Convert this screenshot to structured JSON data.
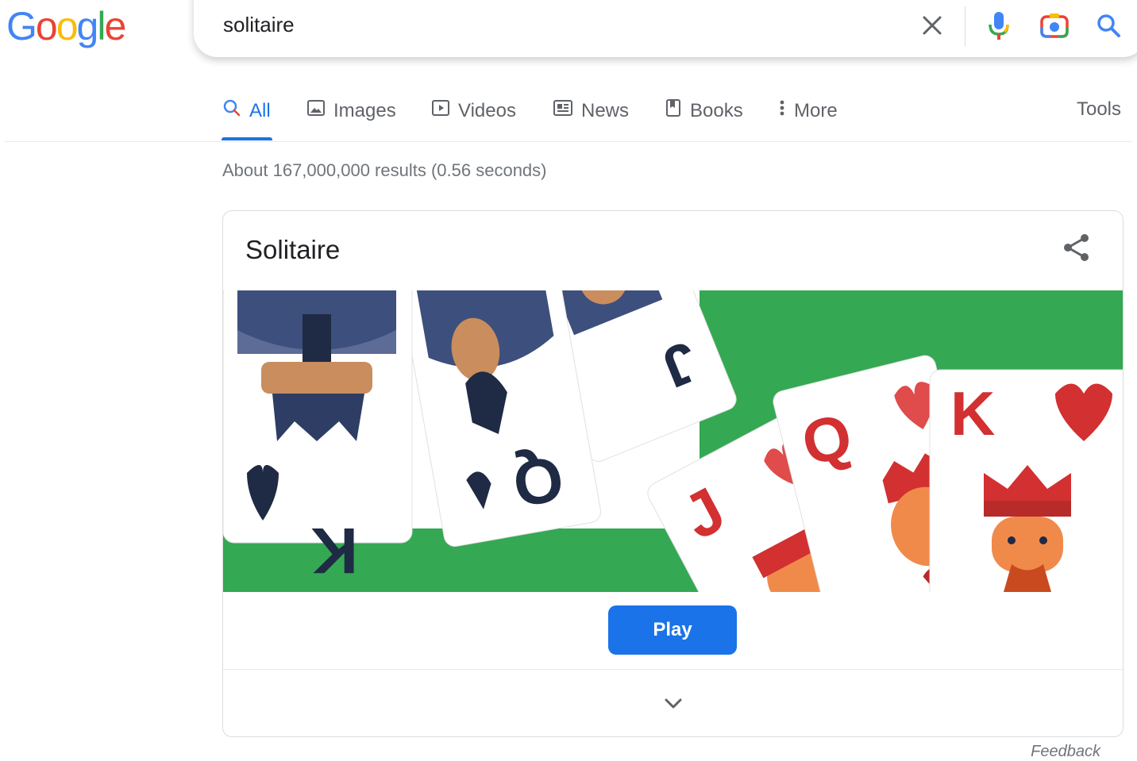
{
  "logo": {
    "text": "Google",
    "letters": [
      "G",
      "o",
      "o",
      "g",
      "l",
      "e"
    ],
    "colors": [
      "#4285f4",
      "#ea4335",
      "#fbbc05",
      "#4285f4",
      "#34a853",
      "#ea4335"
    ]
  },
  "search": {
    "query": "solitaire",
    "clear_icon": "close-icon",
    "voice_icon": "microphone-icon",
    "lens_icon": "camera-icon",
    "submit_icon": "search-icon"
  },
  "tabs": [
    {
      "label": "All",
      "icon": "search-icon",
      "active": true
    },
    {
      "label": "Images",
      "icon": "image-icon"
    },
    {
      "label": "Videos",
      "icon": "play-icon"
    },
    {
      "label": "News",
      "icon": "newspaper-icon"
    },
    {
      "label": "Books",
      "icon": "book-icon"
    },
    {
      "label": "More",
      "icon": "more-vertical-icon"
    }
  ],
  "tools_label": "Tools",
  "result_stats": "About 167,000,000 results (0.56 seconds)",
  "card": {
    "title": "Solitaire",
    "share_icon": "share-icon",
    "play_label": "Play",
    "expand_icon": "chevron-down-icon",
    "felt_color": "#34a853",
    "cards": [
      {
        "rank": "K",
        "suit": "spade",
        "color": "#1f2a44"
      },
      {
        "rank": "Q",
        "suit": "spade",
        "color": "#1f2a44"
      },
      {
        "rank": "J",
        "suit": "spade",
        "color": "#1f2a44"
      },
      {
        "rank": "J",
        "suit": "heart",
        "color": "#d23031"
      },
      {
        "rank": "Q",
        "suit": "heart",
        "color": "#d23031"
      },
      {
        "rank": "K",
        "suit": "heart",
        "color": "#d23031"
      }
    ]
  },
  "feedback_label": "Feedback",
  "colors": {
    "accent": "#1a73e8",
    "muted": "#5f6368"
  }
}
